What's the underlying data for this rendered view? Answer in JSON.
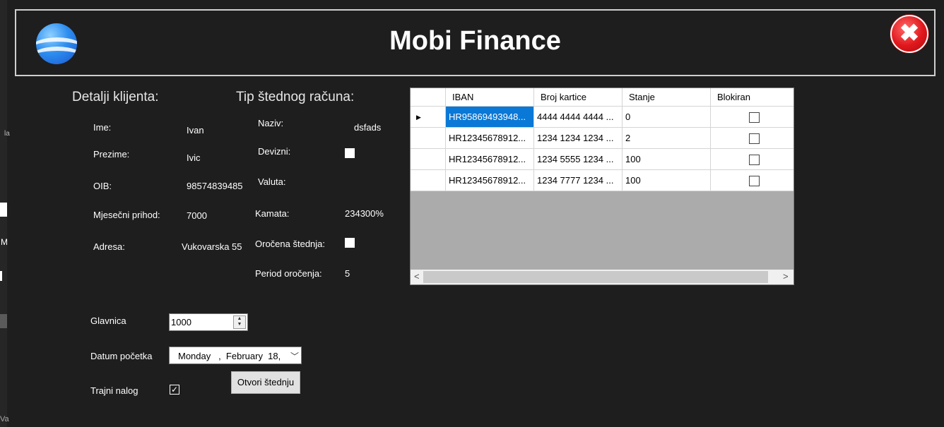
{
  "header": {
    "title": "Mobi Finance",
    "close_symbol": "✖"
  },
  "left_edge": {
    "letter_1": "la",
    "letter_2": "M",
    "letter_3": "Va"
  },
  "client": {
    "heading": "Detalji klijenta:",
    "fields": [
      {
        "label": "Ime:",
        "value": "Ivan"
      },
      {
        "label": "Prezime:",
        "value": "Ivic"
      },
      {
        "label": "OIB:",
        "value": "98574839485"
      },
      {
        "label": "Mjesečni prihod:",
        "value": "7000"
      },
      {
        "label": "Adresa:",
        "value": "Vukovarska 55"
      }
    ]
  },
  "account_type": {
    "heading": "Tip štednog računa:",
    "naziv_label": "Naziv:",
    "naziv_value": "dsfads",
    "devizni_label": "Devizni:",
    "devizni_checked": false,
    "valuta_label": "Valuta:",
    "valuta_value": "",
    "kamata_label": "Kamata:",
    "kamata_value": "234300%",
    "orocena_label": "Oročena štednja:",
    "orocena_checked": false,
    "period_label": "Period oročenja:",
    "period_value": "5"
  },
  "form": {
    "glavnica_label": "Glavnica",
    "glavnica_value": "1000",
    "datum_label": "Datum početka",
    "datum_value": "Monday   ,  February  18,",
    "trajni_label": "Trajni nalog",
    "trajni_checked": true,
    "open_button": "Otvori štednju"
  },
  "grid": {
    "columns": [
      "IBAN",
      "Broj kartice",
      "Stanje",
      "Blokiran"
    ],
    "rows": [
      {
        "iban": "HR95869493948...",
        "card": "4444 4444 4444 ...",
        "balance": "0",
        "blocked": false
      },
      {
        "iban": "HR12345678912...",
        "card": "1234 1234 1234 ...",
        "balance": "2",
        "blocked": false
      },
      {
        "iban": "HR12345678912...",
        "card": "1234 5555 1234 ...",
        "balance": "100",
        "blocked": false
      },
      {
        "iban": "HR12345678912...",
        "card": "1234 7777 1234 ...",
        "balance": "100",
        "blocked": false
      }
    ]
  },
  "colors": {
    "background": "#1e1e1e",
    "selection": "#0a78d7",
    "close_red": "#e0171c"
  }
}
